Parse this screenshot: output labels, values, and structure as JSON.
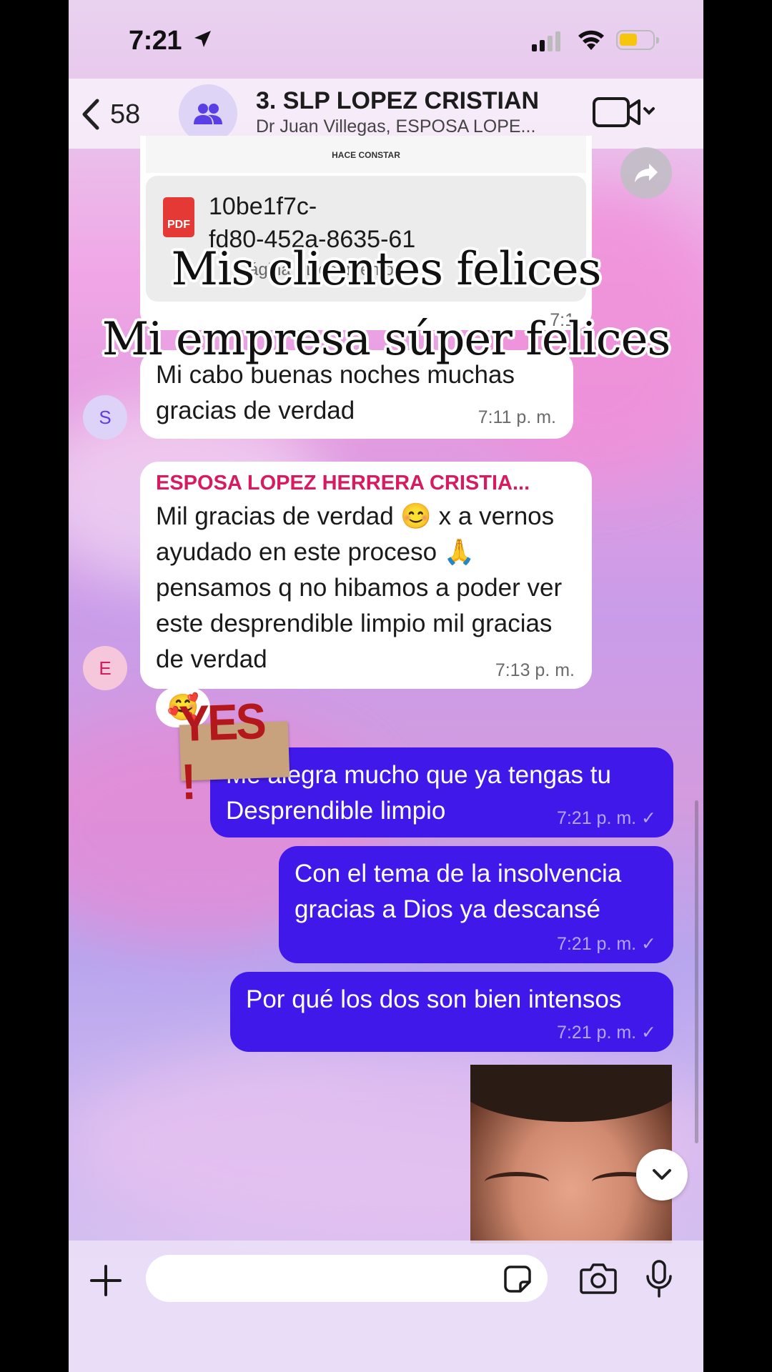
{
  "status_bar": {
    "time": "7:21"
  },
  "header": {
    "back_count": "58",
    "group_title": "3. SLP  LOPEZ CRISTIAN",
    "group_members": "Dr Juan Villegas, ESPOSA LOPE..."
  },
  "pdf_message": {
    "doc_header": "HACE CONSTAR",
    "pdf_badge": "PDF",
    "file_name_line1": "10be1f7c-",
    "file_name_line2": "fd80-452a-8635-61",
    "file_meta": "Página · Documento",
    "time": "7:1"
  },
  "overlay": {
    "line1": "Mis clientes felices",
    "line2": "Mi empresa súper felices"
  },
  "messages": [
    {
      "sender_initial": "S",
      "text": "Mi cabo buenas noches muchas gracias de verdad",
      "time": "7:11 p. m."
    },
    {
      "sender_initial": "E",
      "sender_name": "ESPOSA LOPEZ HERRERA CRISTIA...",
      "text": "Mil gracias de verdad 😊 x a vernos ayudado en este proceso 🙏 pensamos q no hibamos a poder ver este desprendible limpio mil gracias de verdad",
      "time": "7:13 p. m.",
      "reaction": "🥰"
    }
  ],
  "sticker": {
    "text": "YES !"
  },
  "outgoing": [
    {
      "text": "Me alegra mucho que ya tengas tu Desprendible limpio",
      "time": "7:21 p. m. ✓"
    },
    {
      "text": "Con el tema de la insolvencia gracias a Dios ya descansé",
      "time": "7:21 p. m. ✓"
    },
    {
      "text": "Por qué los dos son bien intensos",
      "time": "7:21 p. m. ✓"
    }
  ],
  "input": {
    "placeholder": ""
  },
  "colors": {
    "outgoing_bubble": "#4019ea",
    "sender_name": "#d81b60",
    "accent": "#5b3fe6"
  }
}
